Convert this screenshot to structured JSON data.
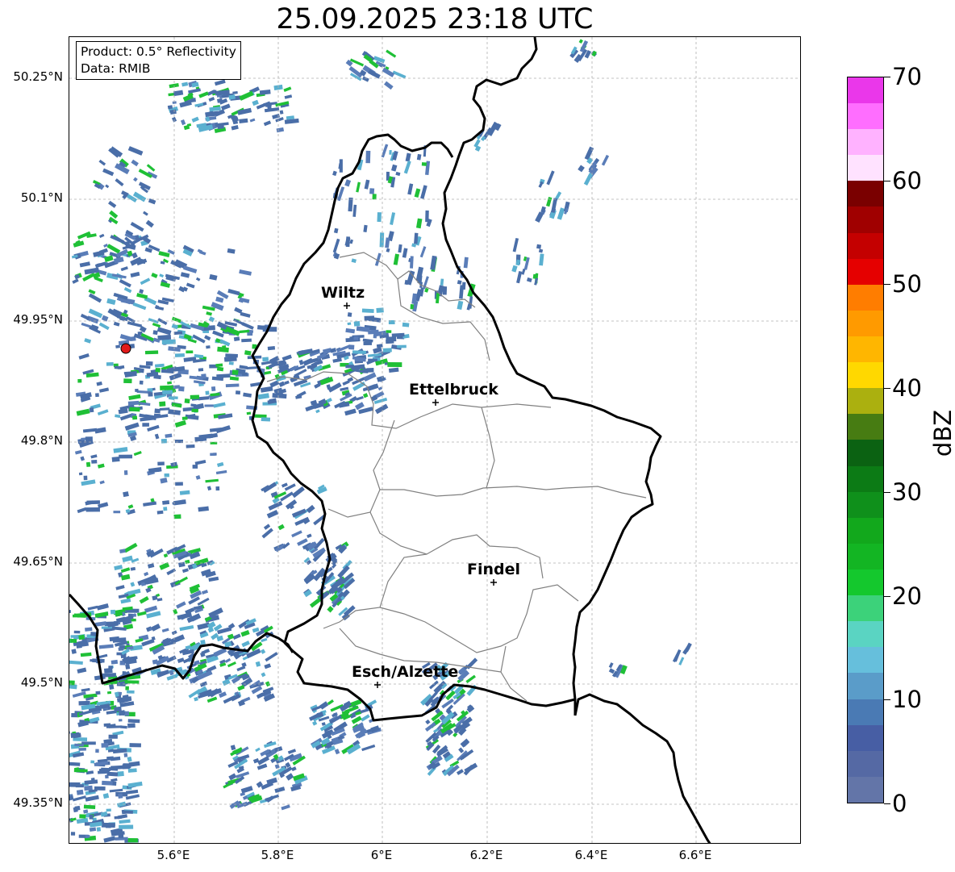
{
  "title": "25.09.2025 23:18 UTC",
  "info": {
    "product": "Product: 0.5° Reflectivity",
    "data": "Data: RMIB"
  },
  "lat_labels": [
    "50.25°N",
    "50.1°N",
    "49.95°N",
    "49.8°N",
    "49.65°N",
    "49.5°N",
    "49.35°N"
  ],
  "lon_labels": [
    "5.6°E",
    "5.8°E",
    "6°E",
    "6.2°E",
    "6.4°E",
    "6.6°E"
  ],
  "cities": [
    {
      "name": "Wiltz"
    },
    {
      "name": "Ettelbruck"
    },
    {
      "name": "Findel"
    },
    {
      "name": "Esch/Alzette"
    }
  ],
  "colorbar": {
    "label": "dBZ",
    "tick_labels": [
      "0",
      "10",
      "20",
      "30",
      "40",
      "50",
      "60",
      "70"
    ],
    "range": [
      0,
      70
    ],
    "colors": [
      "#6375a8",
      "#5569a4",
      "#475ea4",
      "#4a7ab4",
      "#5a9cc9",
      "#66bfdc",
      "#5ad4c2",
      "#3cd27a",
      "#14c82d",
      "#13b523",
      "#12a81c",
      "#0f901b",
      "#0c7b15",
      "#0b6212",
      "#477c12",
      "#abb00f",
      "#ffd800",
      "#ffb600",
      "#ff9a00",
      "#ff7d00",
      "#e50000",
      "#c40000",
      "#a00000",
      "#7a0000",
      "#ffe2ff",
      "#ffb2ff",
      "#ff6eff",
      "#ea37ea"
    ]
  },
  "colors": {
    "echo_main": "#4a6ea8",
    "echo_light": "#5ab0d0",
    "echo_green": "#1fc036",
    "echo_yellow": "#d8c000",
    "radar_marker": "#e11a1a",
    "grid": "#b0b0b0",
    "border": "#000000",
    "district": "#808080"
  }
}
